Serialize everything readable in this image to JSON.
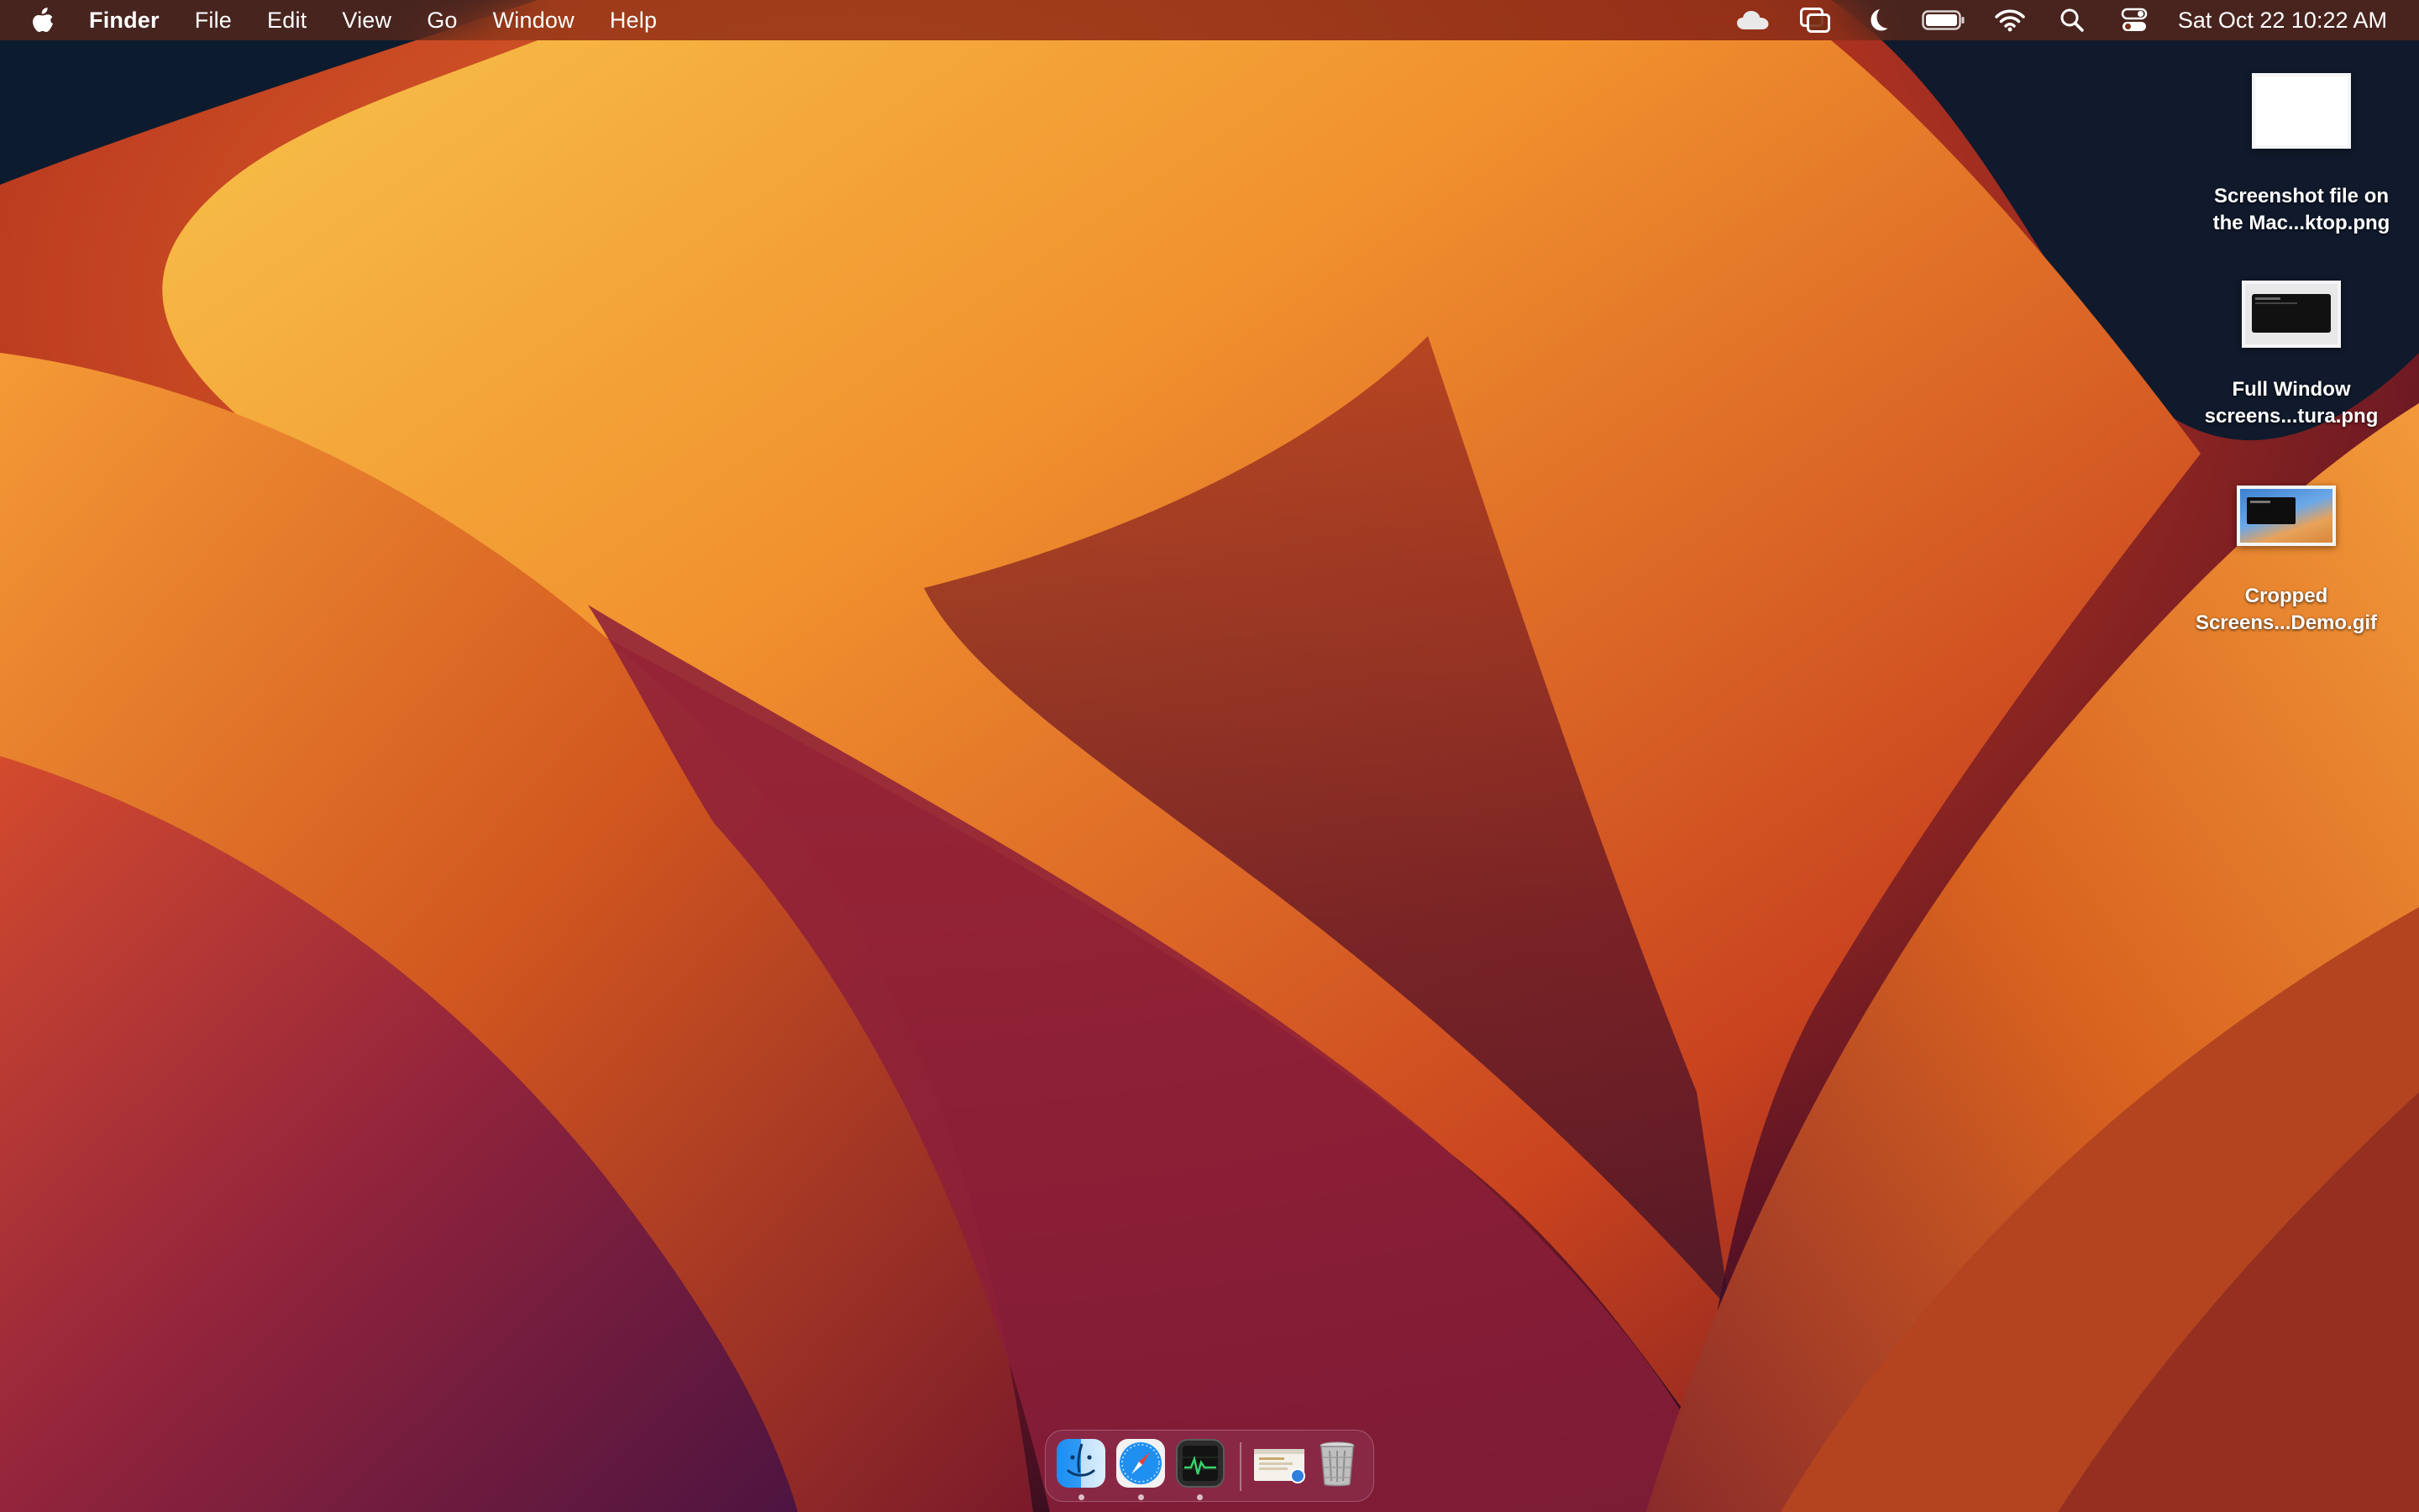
{
  "menubar": {
    "app_name": "Finder",
    "menus": [
      "File",
      "Edit",
      "View",
      "Go",
      "Window",
      "Help"
    ],
    "status_icons": [
      "icloud-icon",
      "window-switcher-icon",
      "moon-icon",
      "battery-icon",
      "wifi-icon",
      "search-icon",
      "control-center-icon"
    ],
    "clock": "Sat Oct 22  10:22 AM"
  },
  "desktop": {
    "files": [
      {
        "name_line1": "Screenshot file on",
        "name_line2": "the Mac...ktop.png",
        "thumbnail": "blank-white"
      },
      {
        "name_line1": "Full Window",
        "name_line2": "screens...tura.png",
        "thumbnail": "terminal-window"
      },
      {
        "name_line1": "Cropped",
        "name_line2": "Screens...Demo.gif",
        "thumbnail": "desktop-with-terminal"
      }
    ]
  },
  "dock": {
    "apps": [
      {
        "name": "Finder",
        "icon": "finder-icon",
        "running": true
      },
      {
        "name": "Safari",
        "icon": "safari-icon",
        "running": true
      },
      {
        "name": "Activity Monitor",
        "icon": "activity-monitor-icon",
        "running": true
      }
    ],
    "extras": [
      {
        "name": "Screenshot document",
        "icon": "document-preview-icon"
      },
      {
        "name": "Trash",
        "icon": "trash-icon"
      }
    ]
  },
  "colors": {
    "accent_orange": "#e8762a",
    "menubar_bg": "#7a2f16",
    "wallpaper_dark": "#0e1a2a"
  }
}
